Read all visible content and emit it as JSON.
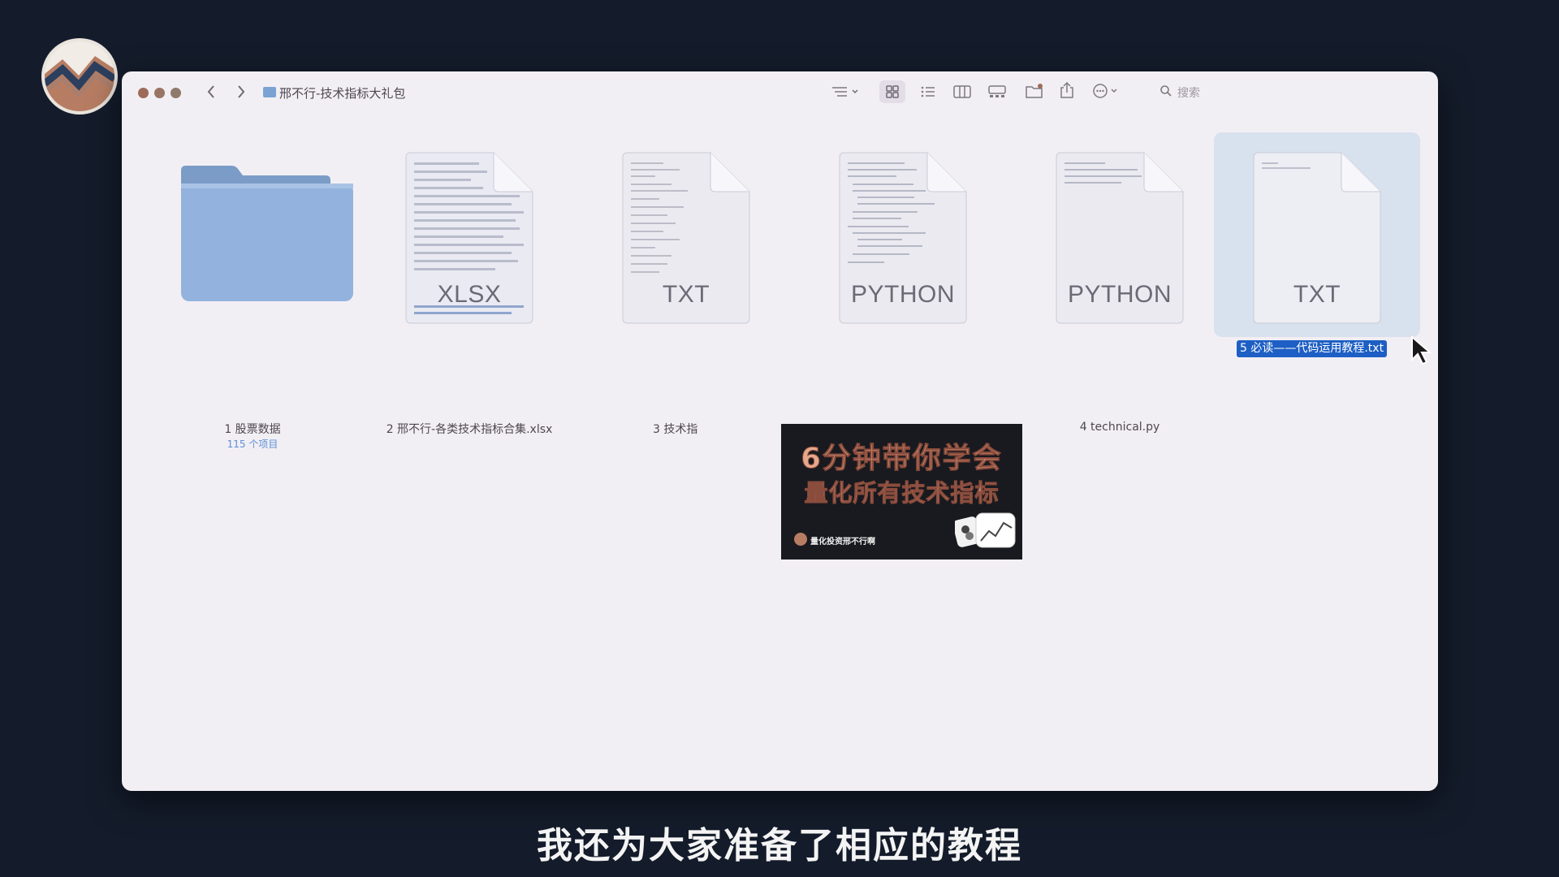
{
  "window": {
    "path_title": "邢不行-技术指标大礼包",
    "search_placeholder": "搜索"
  },
  "toolbar_icons": [
    "back-icon",
    "forward-icon",
    "sort-icon",
    "icon-view-icon",
    "list-view-icon",
    "column-view-icon",
    "gallery-view-icon",
    "new-folder-icon",
    "share-icon",
    "more-icon",
    "search-icon"
  ],
  "items": [
    {
      "name": "1 股票数据",
      "sub": "115 个项目",
      "kind": "folder"
    },
    {
      "name": "2 邢不行-各类技术指标合集.xlsx",
      "type": "XLSX"
    },
    {
      "name": "3 技术指",
      "type": "TXT"
    },
    {
      "name": "",
      "type": "PYTHON"
    },
    {
      "name": "4 technical.py",
      "type": "PYTHON"
    },
    {
      "name": "5 必读——代码运用教程.txt",
      "type": "TXT",
      "selected": true
    }
  ],
  "thumbnail": {
    "line1": "6分钟带你学会",
    "line2": "量化所有技术指标",
    "author": "量化投资邢不行啊"
  },
  "subtitle": "我还为大家准备了相应的教程",
  "colors": {
    "background": "#141c2b",
    "window": "#f2eff4",
    "folder": "#8fb1dc",
    "selection": "#1d5fc4",
    "thumb_text": "#e6a78b"
  }
}
